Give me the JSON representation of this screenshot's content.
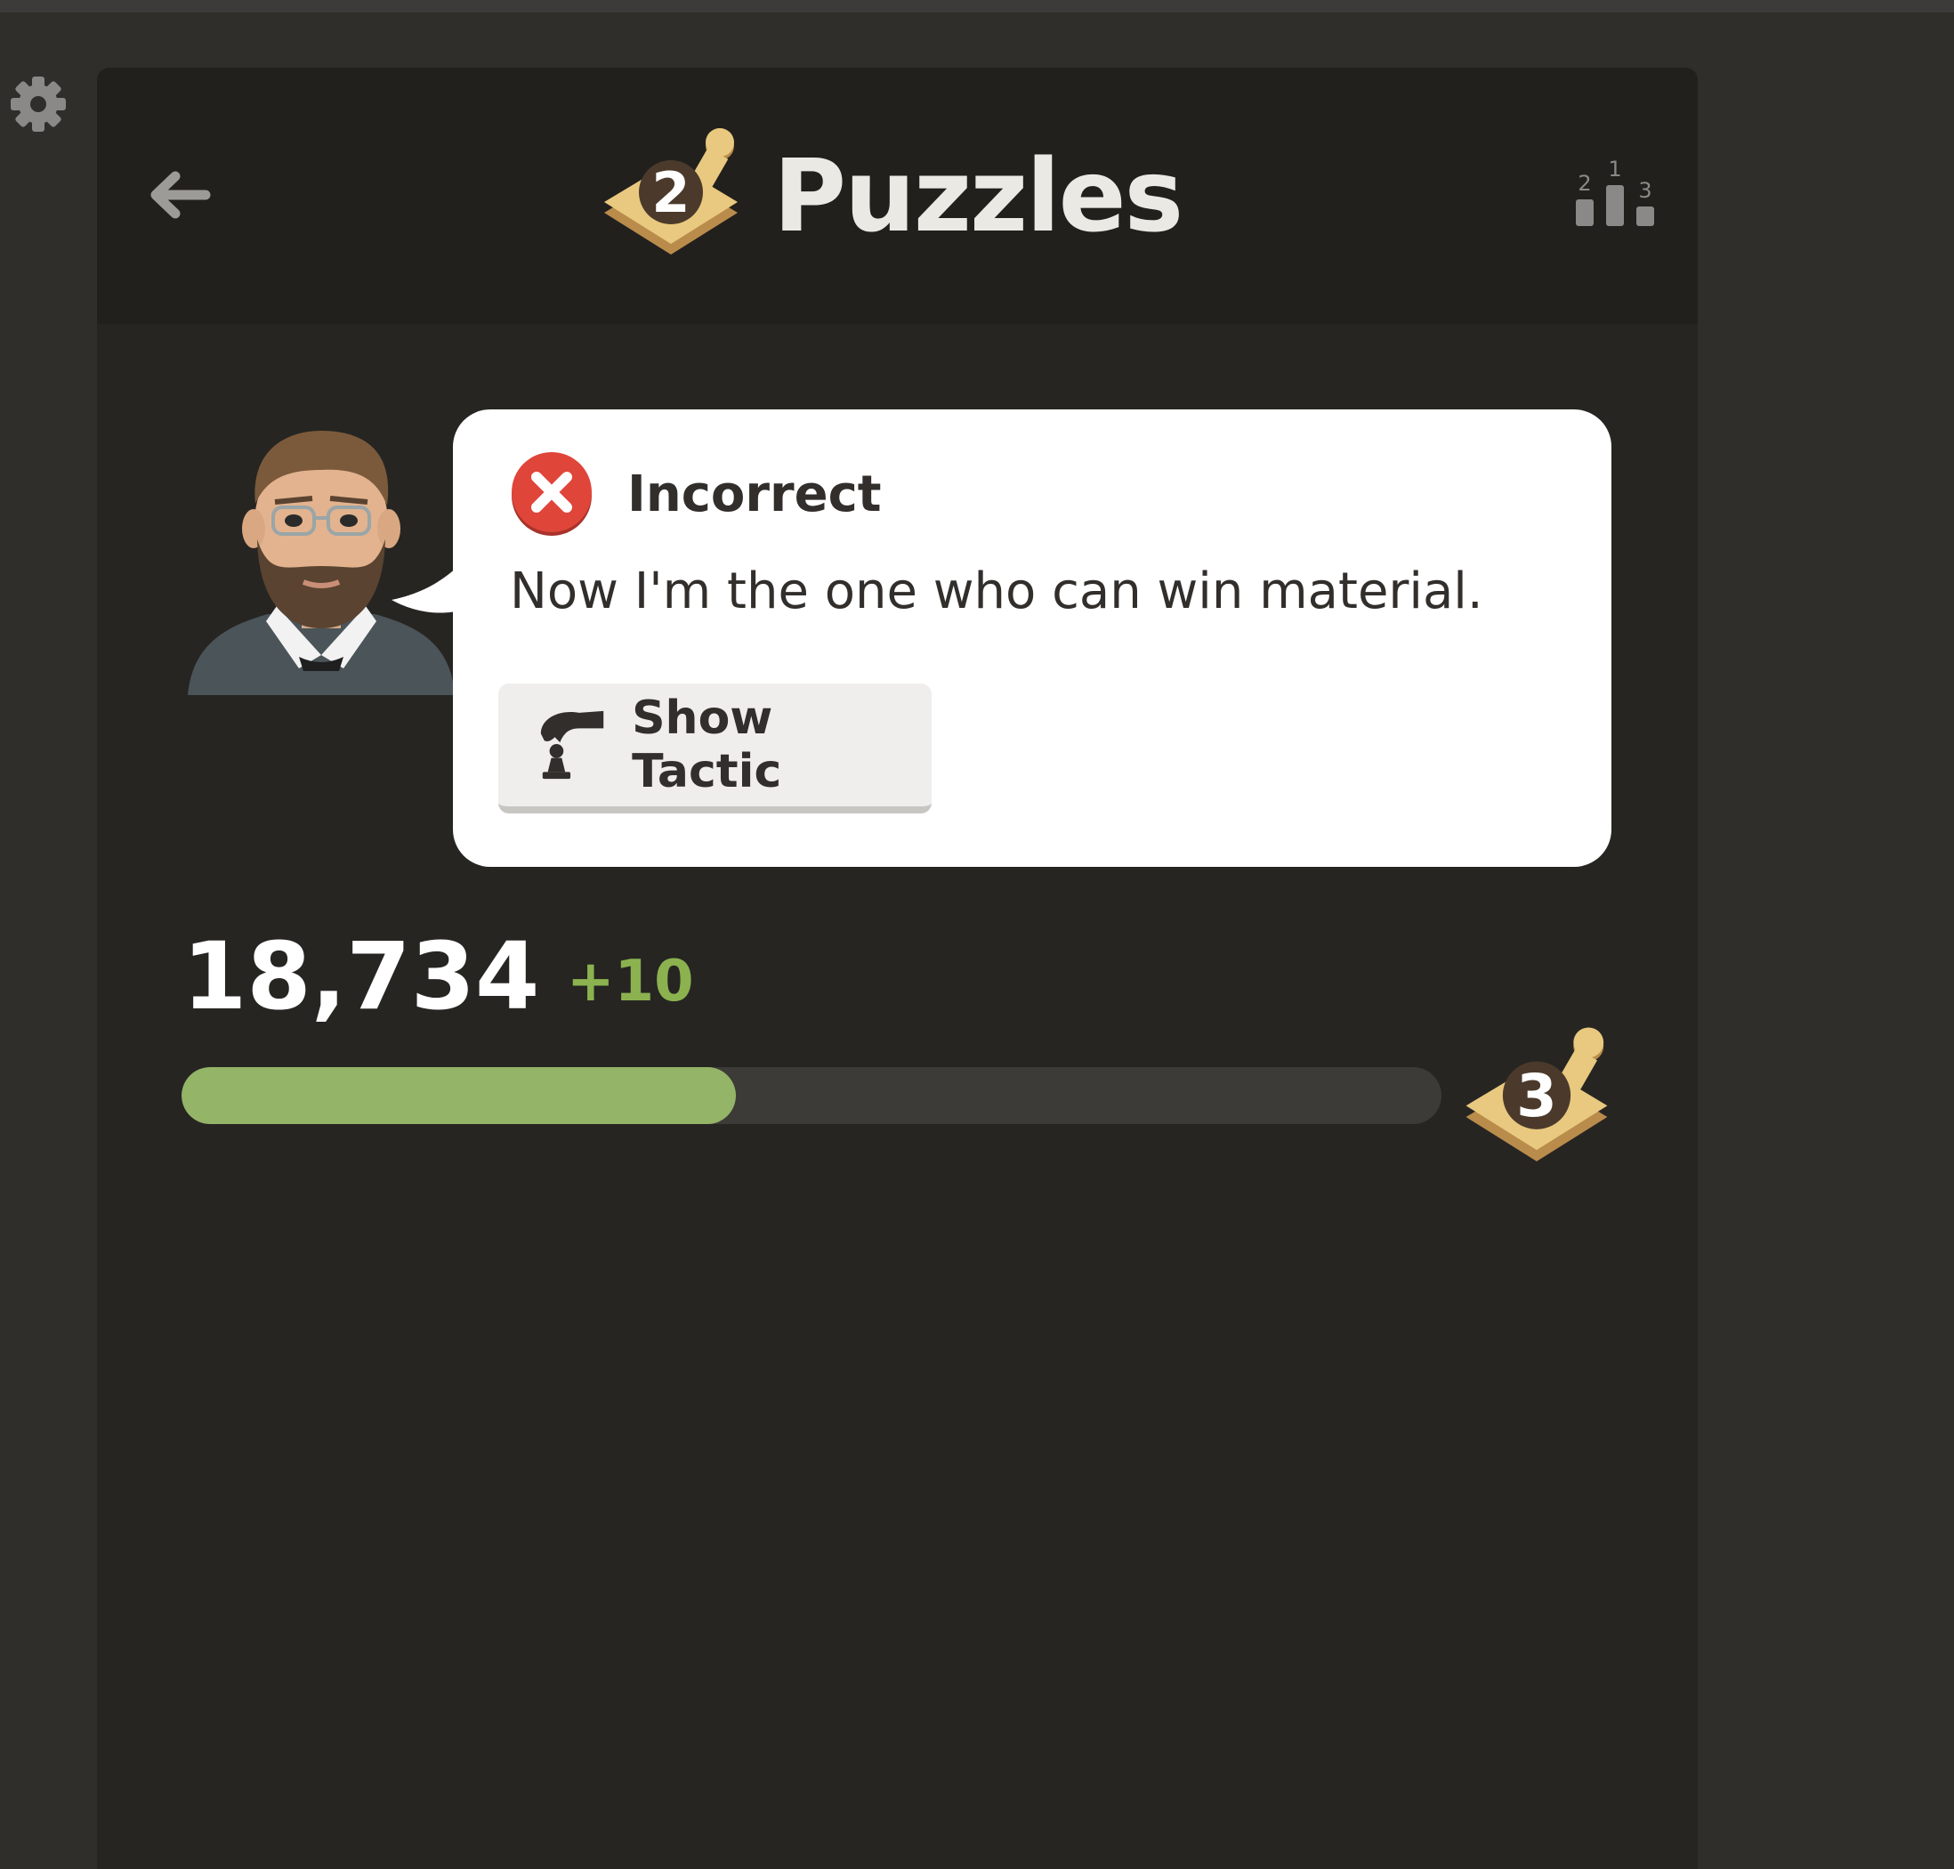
{
  "header": {
    "title": "Puzzles",
    "current_level": "2",
    "back_icon": "back-arrow-icon",
    "leaderboard_icon": "leaderboard-podium-icon",
    "leaderboard_ranks": [
      "2",
      "1",
      "3"
    ]
  },
  "sidebar": {
    "settings_icon": "gear-icon"
  },
  "feedback": {
    "status": "Incorrect",
    "status_icon": "x-circle-icon",
    "message": "Now I'm the one who can win material.",
    "show_tactic_label": "Show Tactic",
    "show_tactic_icon": "tactic-hint-icon"
  },
  "progress": {
    "score": "18,734",
    "delta": "+10",
    "fill_fraction": 0.44,
    "next_level": "3"
  },
  "colors": {
    "background": "#302e2b",
    "panel": "#262522",
    "header": "#21201d",
    "accent_green": "#8bb24f",
    "progress_fill": "#94b468",
    "error_red": "#e0453a",
    "bubble": "#ffffff"
  }
}
